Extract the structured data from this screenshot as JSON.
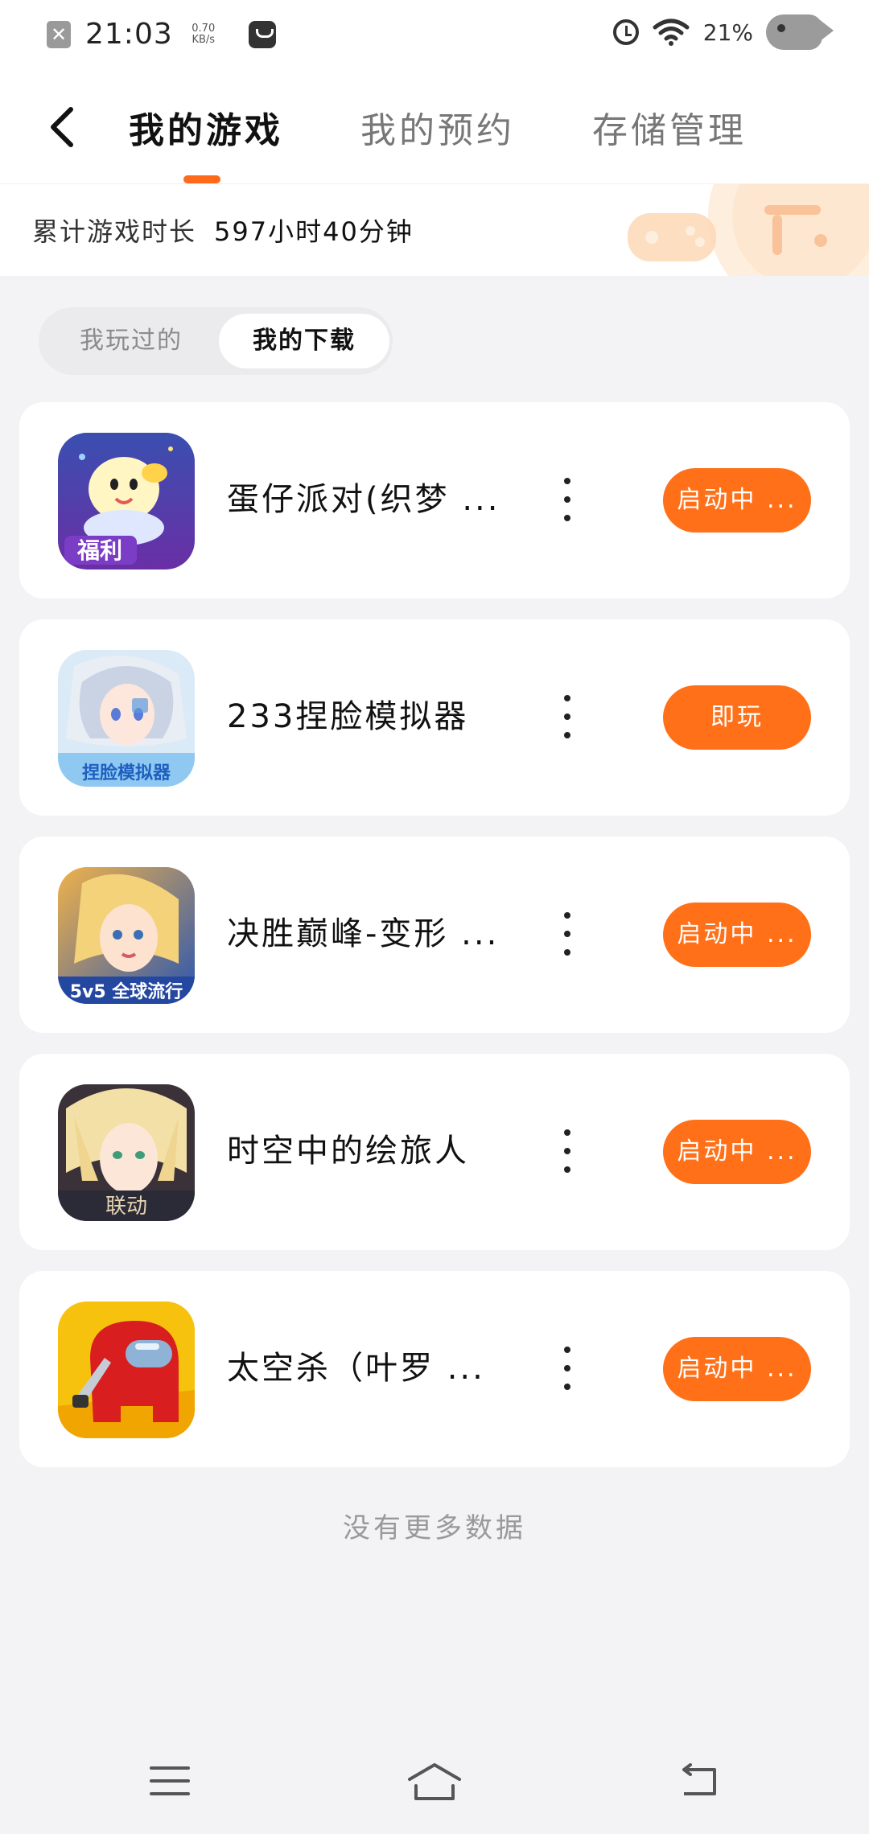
{
  "status_bar": {
    "time": "21:03",
    "net_speed_value": "0.70",
    "net_speed_unit": "KB/s",
    "battery": "21%"
  },
  "header": {
    "tabs": [
      {
        "label": "我的游戏",
        "active": true
      },
      {
        "label": "我的预约",
        "active": false
      },
      {
        "label": "存储管理",
        "active": false
      }
    ],
    "accent_color": "#ff6a1a"
  },
  "playtime": {
    "label": "累计游戏时长",
    "value": "597小时40分钟"
  },
  "segment": {
    "played": "我玩过的",
    "downloads": "我的下载",
    "selected": "我的下载"
  },
  "games": [
    {
      "name": "蛋仔派对(织梦 ...",
      "action": "启动中 ...",
      "icon": "eggy-party-icon",
      "icon_text": "福利"
    },
    {
      "name": "233捏脸模拟器",
      "action": "即玩",
      "icon": "face-sim-icon",
      "icon_text": "捏脸模拟器"
    },
    {
      "name": "决胜巅峰-变形 ...",
      "action": "启动中 ...",
      "icon": "moba-icon",
      "icon_text": "5v5 全球流行"
    },
    {
      "name": "时空中的绘旅人",
      "action": "启动中 ...",
      "icon": "anime-boy-icon",
      "icon_text": "联动"
    },
    {
      "name": "太空杀（叶罗 ...",
      "action": "启动中 ...",
      "icon": "among-us-icon",
      "icon_text": ""
    }
  ],
  "footer": {
    "no_more": "没有更多数据"
  },
  "colors": {
    "button": "#ff7019",
    "background": "#f3f3f5"
  }
}
